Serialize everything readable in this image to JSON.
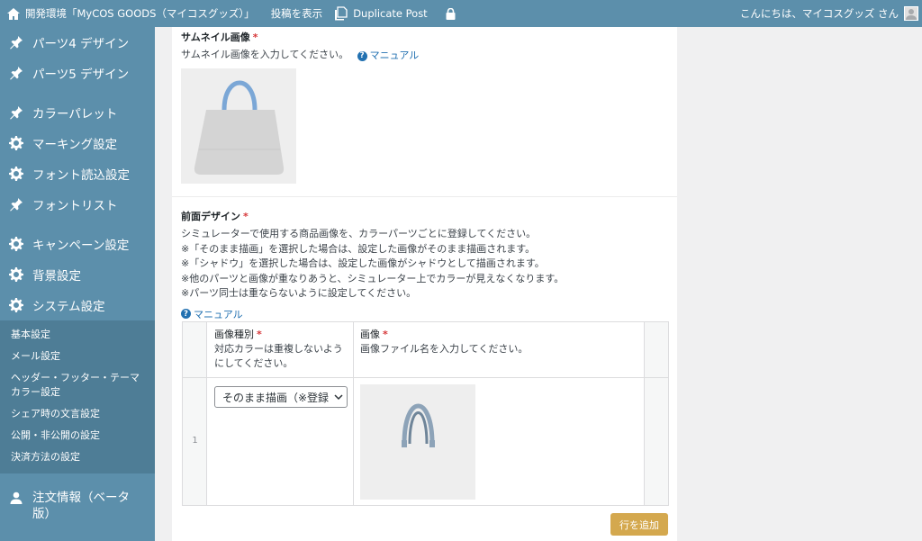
{
  "adminbar": {
    "site_title": "開発環境「MyCOS GOODS（マイコスグッズ）」",
    "view_post": "投稿を表示",
    "duplicate_post": "Duplicate Post",
    "greeting": "こんにちは、マイコスグッズ さん"
  },
  "sidebar": {
    "items": [
      {
        "label": "パーツ4 デザイン",
        "icon": "pin-icon"
      },
      {
        "label": "パーツ5 デザイン",
        "icon": "pin-icon"
      },
      {
        "label": "カラーパレット",
        "icon": "pin-icon"
      },
      {
        "label": "マーキング設定",
        "icon": "gear-icon"
      },
      {
        "label": "フォント読込設定",
        "icon": "gear-icon"
      },
      {
        "label": "フォントリスト",
        "icon": "pin-icon"
      },
      {
        "label": "キャンペーン設定",
        "icon": "gear-icon"
      },
      {
        "label": "背景設定",
        "icon": "gear-icon"
      },
      {
        "label": "システム設定",
        "icon": "gear-icon"
      }
    ],
    "submenu": [
      "基本設定",
      "メール設定",
      "ヘッダー・フッター・テーマカラー設定",
      "シェア時の文言設定",
      "公開・非公開の設定",
      "決済方法の設定"
    ],
    "orders": {
      "label": "注文情報（ベータ版）",
      "icon": "user-icon"
    }
  },
  "thumbnail": {
    "label": "サムネイル画像",
    "required_mark": "*",
    "description": "サムネイル画像を入力してください。",
    "manual_link": "マニュアル"
  },
  "front_design": {
    "label": "前面デザイン",
    "required_mark": "*",
    "description_lines": [
      "シミュレーターで使用する商品画像を、カラーパーツごとに登録してください。",
      "※「そのまま描画」を選択した場合は、設定した画像がそのまま描画されます。",
      "※「シャドウ」を選択した場合は、設定した画像がシャドウとして描画されます。",
      "※他のパーツと画像が重なりあうと、シミュレーター上でカラーが見えなくなります。",
      "※パーツ同士は重ならないように設定してください。"
    ],
    "manual_link": "マニュアル",
    "table": {
      "col1_title": "画像種別",
      "col1_desc": "対応カラーは重複しないようにしてください。",
      "col2_title": "画像",
      "col2_desc": "画像ファイル名を入力してください。",
      "required_mark": "*",
      "rows": [
        {
          "num": "1",
          "type": "そのまま描画（※登録"
        }
      ]
    },
    "add_row_button": "行を追加"
  },
  "colors": {
    "sidebar_bg": "#5c8fab",
    "accent_button": "#d4a84e",
    "link": "#2271b1",
    "required": "#d63638"
  }
}
